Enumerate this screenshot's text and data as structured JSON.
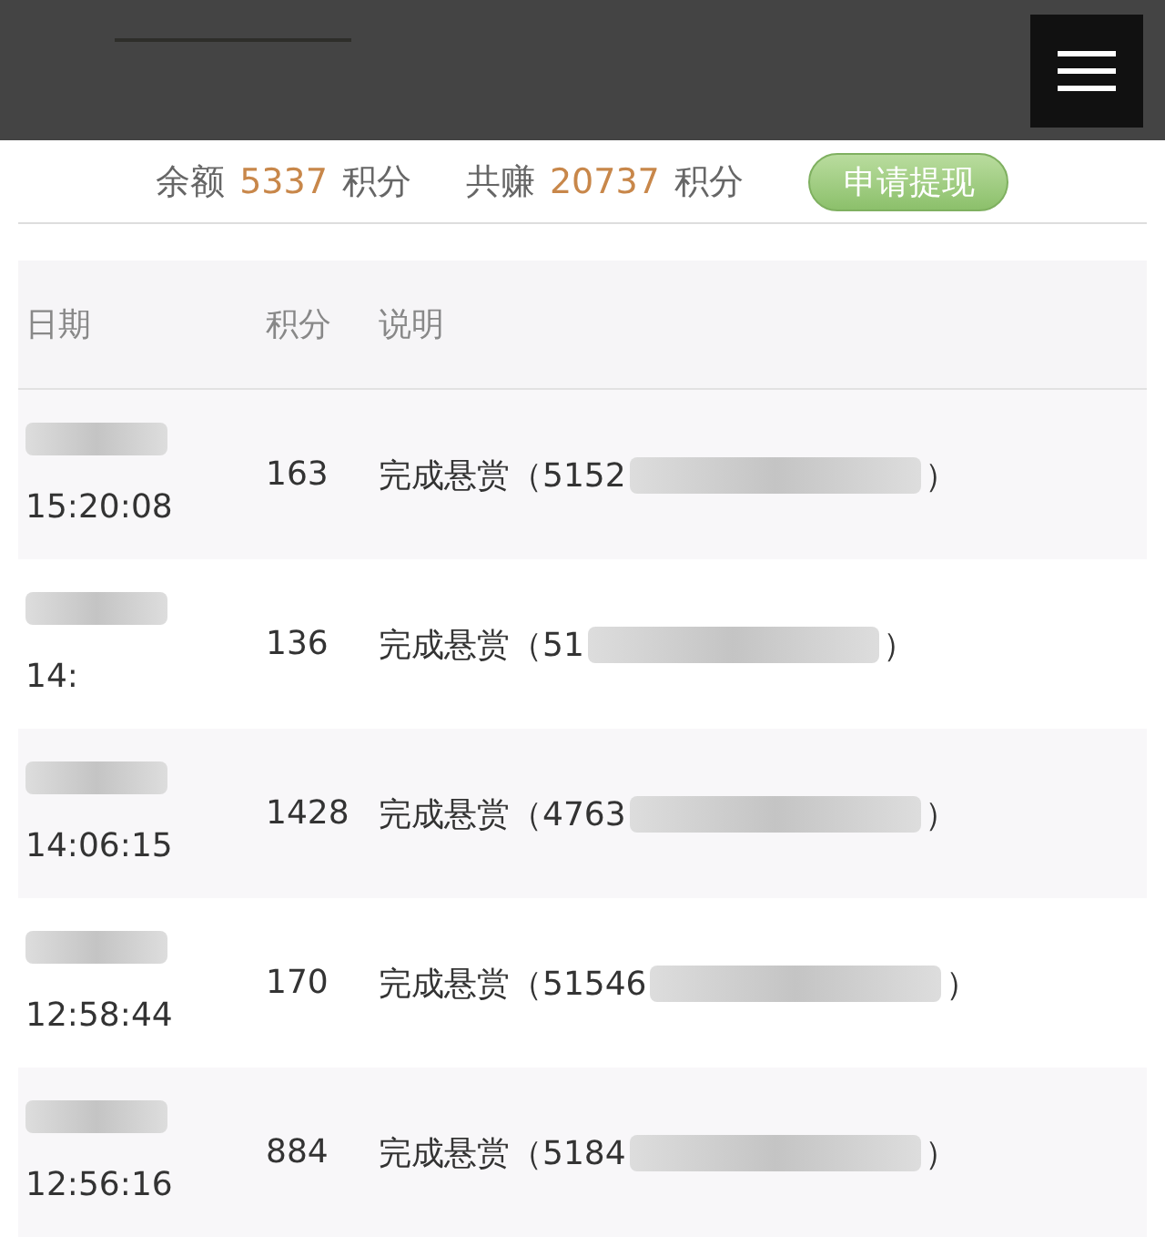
{
  "summary": {
    "balance_label": "余额",
    "balance": "5337",
    "balance_unit": "积分",
    "earned_label": "共赚",
    "earned": "20737",
    "earned_unit": "积分",
    "button": "申请提现"
  },
  "table": {
    "columns": [
      "日期",
      "积分",
      "说明"
    ],
    "rows": [
      {
        "time": "15:20:08",
        "points": "163",
        "desc_start": "完成悬赏（5152",
        "desc_end": "）"
      },
      {
        "time": "14:",
        "points": "136",
        "desc_start": "完成悬赏（51",
        "desc_end": "）"
      },
      {
        "time": "14:06:15",
        "points": "1428",
        "desc_start": "完成悬赏（4763",
        "desc_end": "）"
      },
      {
        "time": "12:58:44",
        "points": "170",
        "desc_start": "完成悬赏（51546",
        "desc_end": "）"
      },
      {
        "time": "12:56:16",
        "points": "884",
        "desc_start": "完成悬赏（5184",
        "desc_end": "）"
      }
    ]
  }
}
